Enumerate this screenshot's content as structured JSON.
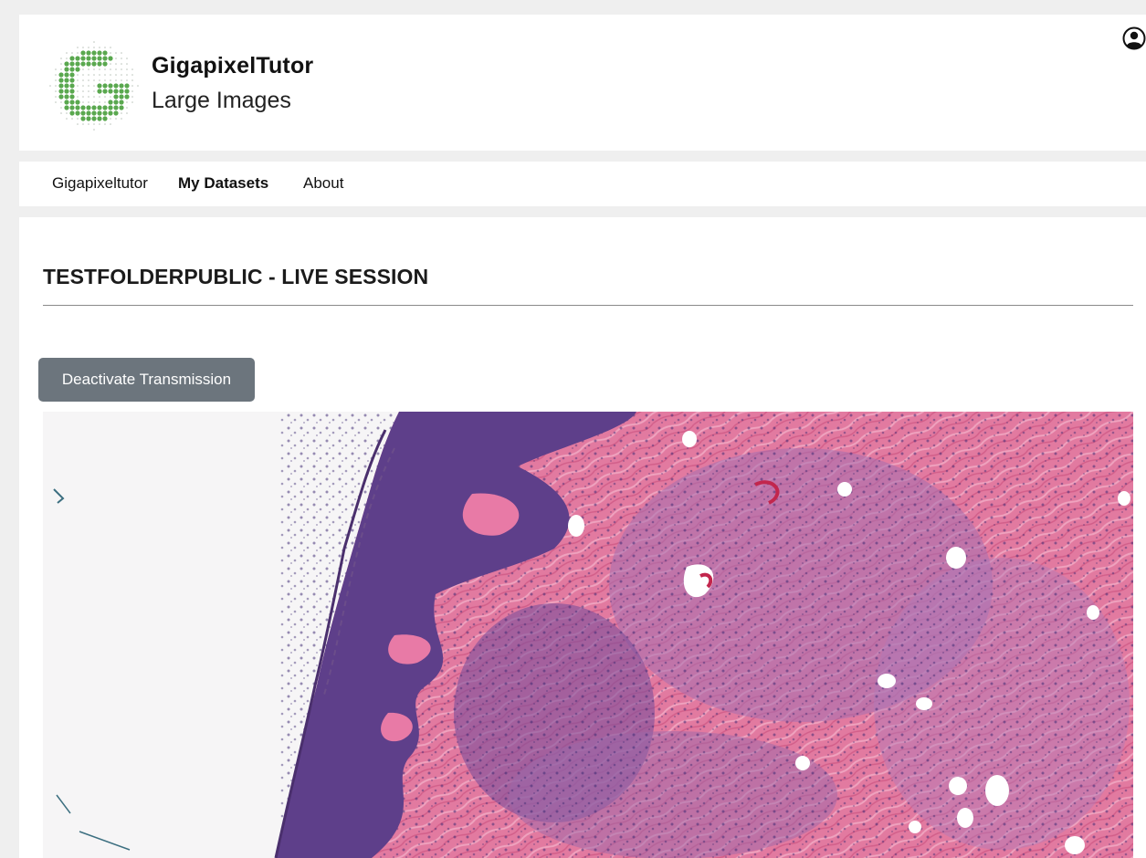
{
  "header": {
    "brand_title": "GigapixelTutor",
    "brand_subtitle": "Large Images",
    "logo_icon": "dotted-g-logo",
    "user_icon": "user-circle-icon"
  },
  "nav": {
    "items": [
      {
        "label": "Gigapixeltutor",
        "active": false
      },
      {
        "label": "My Datasets",
        "active": true
      },
      {
        "label": "About",
        "active": false
      }
    ]
  },
  "main": {
    "title": "TESTFOLDERPUBLIC - LIVE SESSION",
    "transmission_button": "Deactivate Transmission",
    "viewer": {
      "content": "histology slide image (H&E stained skin tissue)"
    }
  },
  "colors": {
    "page_background": "#efefef",
    "button_background": "#6c757d",
    "logo_green": "#5aa84f",
    "tissue_pink": "#e27aa0",
    "tissue_purple": "#5e3f8a"
  }
}
